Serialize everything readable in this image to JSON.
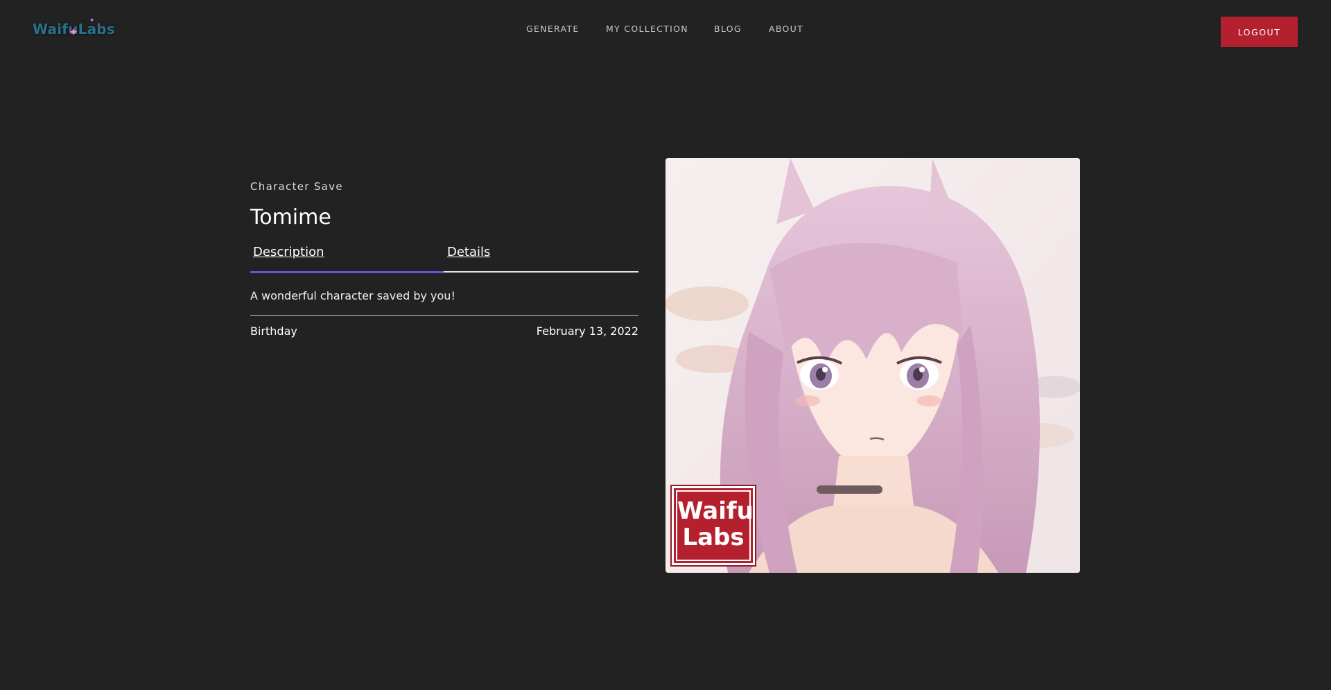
{
  "header": {
    "logo_text": "WaifuLabs",
    "nav": [
      "GENERATE",
      "MY COLLECTION",
      "BLOG",
      "ABOUT"
    ],
    "logout_label": "LOGOUT"
  },
  "character": {
    "subtitle": "Character Save",
    "name": "Tomime",
    "tabs": [
      "Description",
      "Details"
    ],
    "active_tab": "Description",
    "description": "A wonderful character saved by you!",
    "details": [
      {
        "label": "Birthday",
        "value": "February 13, 2022"
      }
    ]
  },
  "portrait": {
    "badge_line1": "Waifu",
    "badge_line2": "Labs"
  },
  "colors": {
    "background": "#222222",
    "accent": "#b5202e",
    "tab_active": "#5d57d6"
  }
}
